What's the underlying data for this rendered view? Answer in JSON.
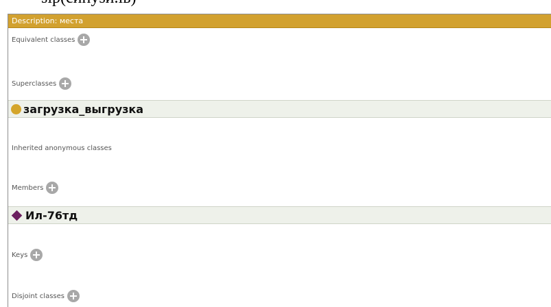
{
  "caption": "ѕір(сипуѕи.ів)",
  "header": {
    "title": "Description: места"
  },
  "sections": {
    "equivalent": {
      "label": "Equivalent classes"
    },
    "superclasses": {
      "label": "Superclasses"
    },
    "inherited": {
      "label": "Inherited anonymous classes"
    },
    "members": {
      "label": "Members"
    },
    "keys": {
      "label": "Keys"
    },
    "disjoint": {
      "label": "Disjoint classes"
    }
  },
  "superclass_item": {
    "name": "загрузка_выгрузка",
    "icon": "class-dot-icon",
    "color": "#d4a52a"
  },
  "member_item": {
    "name": "Ил-76тд",
    "icon": "individual-diamond-icon",
    "color": "#6b1f5f"
  },
  "colors": {
    "header": "#d2a12f",
    "row_bg": "#eef1ea",
    "add_button": "#a8a8a8"
  }
}
